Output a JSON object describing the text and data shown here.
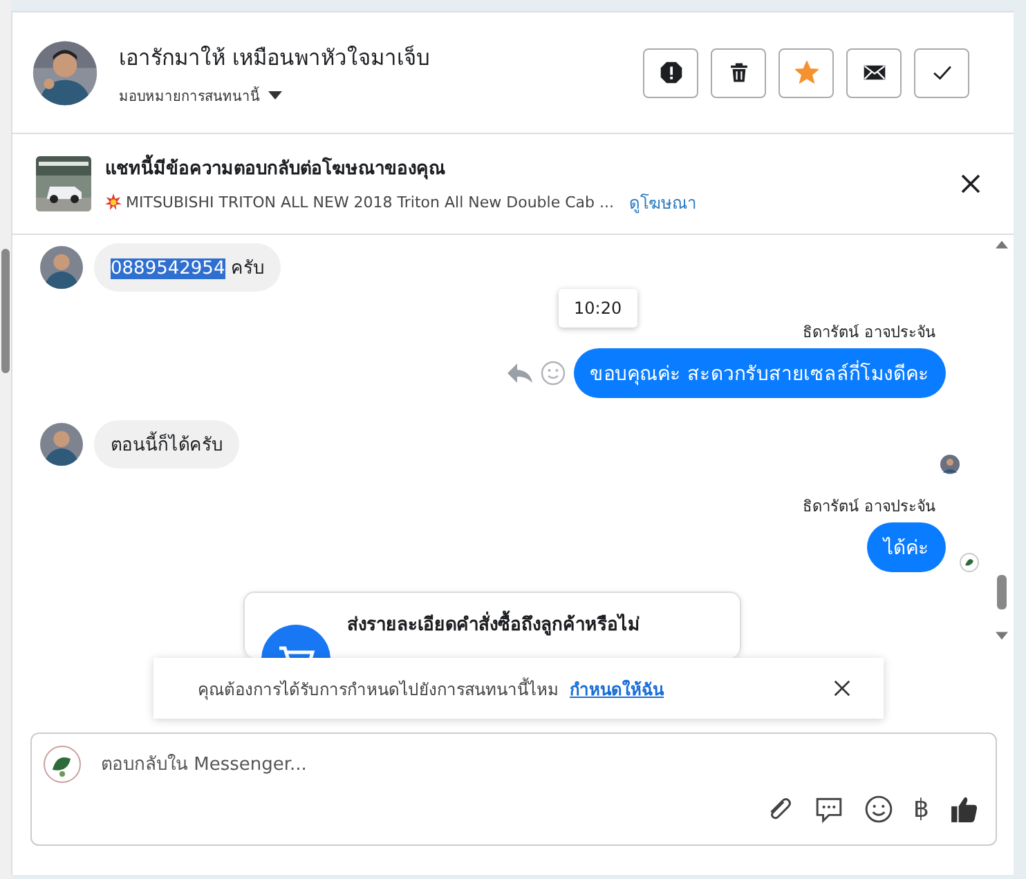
{
  "header": {
    "name": "เอารักมาให้ เหมือนพาหัวใจมาเจ็บ",
    "assign_label": "มอบหมายการสนทนานี้",
    "starred": true
  },
  "ad_banner": {
    "title": "แชทนี้มีข้อความตอบกลับต่อโฆษณาของคุณ",
    "ad_text": "MITSUBISHI TRITON ALL NEW 2018 Triton All New Double Cab ...",
    "link": "ดูโฆษณา"
  },
  "messages": [
    {
      "kind": "incoming",
      "segments": [
        {
          "text": "0889542954",
          "selected": true
        },
        {
          "text": " ครับ",
          "selected": false
        }
      ]
    },
    {
      "kind": "outgoing",
      "sender": "ธิดารัตน์ อาจประจัน",
      "tooltip": "10:20",
      "segments": [
        {
          "text": "ขอบคุณค่ะ สะดวกรับสายเซลล์กี่โมงดีคะ",
          "selected": false
        }
      ]
    },
    {
      "kind": "incoming",
      "seen": true,
      "segments": [
        {
          "text": "ตอนนี้ก็ได้ครับ",
          "selected": false
        }
      ]
    },
    {
      "kind": "outgoing",
      "sender": "ธิดารัตน์ อาจประจัน",
      "seen": true,
      "segments": [
        {
          "text": "ได้ค่ะ",
          "selected": false
        }
      ]
    }
  ],
  "order_card": {
    "title": "ส่งรายละเอียดคำสั่งซื้อถึงลูกค้าหรือไม่"
  },
  "toast": {
    "text": "คุณต้องการได้รับการกำหนดไปยังการสนทนานี้ไหม",
    "link": "กำหนดให้ฉัน"
  },
  "composer": {
    "placeholder": "ตอบกลับใน Messenger...",
    "currency_symbol": "฿"
  }
}
